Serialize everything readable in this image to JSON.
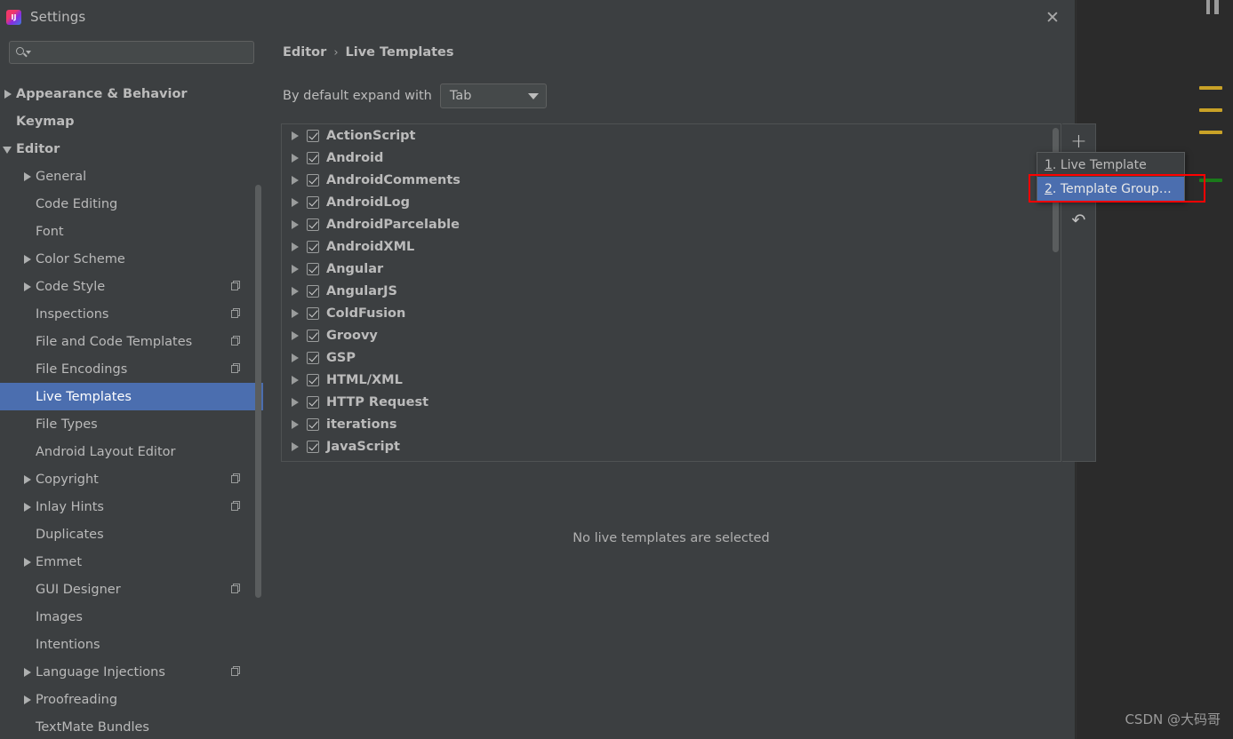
{
  "dialog": {
    "title": "Settings",
    "logo_icon": "intellij-idea-logo-icon",
    "close_icon": "close-icon"
  },
  "search": {
    "icon": "search-icon",
    "value": "",
    "placeholder": ""
  },
  "sidebar": {
    "items": [
      {
        "label": "Appearance & Behavior",
        "twisty": "collapsed",
        "level": 0,
        "bold": true,
        "selected": false,
        "badge": false
      },
      {
        "label": "Keymap",
        "twisty": "none",
        "level": 0,
        "bold": true,
        "selected": false,
        "badge": false
      },
      {
        "label": "Editor",
        "twisty": "expanded",
        "level": 0,
        "bold": true,
        "selected": false,
        "badge": false
      },
      {
        "label": "General",
        "twisty": "collapsed",
        "level": 1,
        "bold": false,
        "selected": false,
        "badge": false
      },
      {
        "label": "Code Editing",
        "twisty": "none",
        "level": 1,
        "bold": false,
        "selected": false,
        "badge": false
      },
      {
        "label": "Font",
        "twisty": "none",
        "level": 1,
        "bold": false,
        "selected": false,
        "badge": false
      },
      {
        "label": "Color Scheme",
        "twisty": "collapsed",
        "level": 1,
        "bold": false,
        "selected": false,
        "badge": false
      },
      {
        "label": "Code Style",
        "twisty": "collapsed",
        "level": 1,
        "bold": false,
        "selected": false,
        "badge": true
      },
      {
        "label": "Inspections",
        "twisty": "none",
        "level": 1,
        "bold": false,
        "selected": false,
        "badge": true
      },
      {
        "label": "File and Code Templates",
        "twisty": "none",
        "level": 1,
        "bold": false,
        "selected": false,
        "badge": true
      },
      {
        "label": "File Encodings",
        "twisty": "none",
        "level": 1,
        "bold": false,
        "selected": false,
        "badge": true
      },
      {
        "label": "Live Templates",
        "twisty": "none",
        "level": 1,
        "bold": false,
        "selected": true,
        "badge": false
      },
      {
        "label": "File Types",
        "twisty": "none",
        "level": 1,
        "bold": false,
        "selected": false,
        "badge": false
      },
      {
        "label": "Android Layout Editor",
        "twisty": "none",
        "level": 1,
        "bold": false,
        "selected": false,
        "badge": false
      },
      {
        "label": "Copyright",
        "twisty": "collapsed",
        "level": 1,
        "bold": false,
        "selected": false,
        "badge": true
      },
      {
        "label": "Inlay Hints",
        "twisty": "collapsed",
        "level": 1,
        "bold": false,
        "selected": false,
        "badge": true
      },
      {
        "label": "Duplicates",
        "twisty": "none",
        "level": 1,
        "bold": false,
        "selected": false,
        "badge": false
      },
      {
        "label": "Emmet",
        "twisty": "collapsed",
        "level": 1,
        "bold": false,
        "selected": false,
        "badge": false
      },
      {
        "label": "GUI Designer",
        "twisty": "none",
        "level": 1,
        "bold": false,
        "selected": false,
        "badge": true
      },
      {
        "label": "Images",
        "twisty": "none",
        "level": 1,
        "bold": false,
        "selected": false,
        "badge": false
      },
      {
        "label": "Intentions",
        "twisty": "none",
        "level": 1,
        "bold": false,
        "selected": false,
        "badge": false
      },
      {
        "label": "Language Injections",
        "twisty": "collapsed",
        "level": 1,
        "bold": false,
        "selected": false,
        "badge": true
      },
      {
        "label": "Proofreading",
        "twisty": "collapsed",
        "level": 1,
        "bold": false,
        "selected": false,
        "badge": false
      },
      {
        "label": "TextMate Bundles",
        "twisty": "none",
        "level": 1,
        "bold": false,
        "selected": false,
        "badge": false
      }
    ]
  },
  "content": {
    "breadcrumb": {
      "parent": "Editor",
      "separator": "›",
      "current": "Live Templates"
    },
    "expand_with": {
      "label": "By default expand with",
      "value": "Tab",
      "arrow_icon": "chevron-down-icon"
    },
    "empty_message": "No live templates are selected",
    "template_groups": [
      {
        "label": "ActionScript",
        "checked": true
      },
      {
        "label": "Android",
        "checked": true
      },
      {
        "label": "AndroidComments",
        "checked": true
      },
      {
        "label": "AndroidLog",
        "checked": true
      },
      {
        "label": "AndroidParcelable",
        "checked": true
      },
      {
        "label": "AndroidXML",
        "checked": true
      },
      {
        "label": "Angular",
        "checked": true
      },
      {
        "label": "AngularJS",
        "checked": true
      },
      {
        "label": "ColdFusion",
        "checked": true
      },
      {
        "label": "Groovy",
        "checked": true
      },
      {
        "label": "GSP",
        "checked": true
      },
      {
        "label": "HTML/XML",
        "checked": true
      },
      {
        "label": "HTTP Request",
        "checked": true
      },
      {
        "label": "iterations",
        "checked": true
      },
      {
        "label": "JavaScript",
        "checked": true
      }
    ],
    "toolbar": {
      "add_label": "+",
      "add_icon": "plus-icon",
      "remove_label": "−",
      "remove_icon": "minus-icon",
      "revert_label": "↶",
      "revert_icon": "revert-arrow-icon"
    }
  },
  "popup_menu": {
    "items": [
      {
        "mnemonic": "1",
        "label": ". Live Template",
        "highlighted": false
      },
      {
        "mnemonic": "2",
        "label": ". Template Group…",
        "highlighted": true
      }
    ]
  },
  "watermark": "CSDN @大码哥",
  "colors": {
    "dialog_bg": "#3c3f41",
    "ide_bg": "#2b2b2b",
    "selection_blue": "#4b6eaf",
    "text": "#bbbbbb",
    "highlight_red": "#ff0000",
    "marker_warn": "#c9a227",
    "marker_ok": "#1a7a1a"
  }
}
